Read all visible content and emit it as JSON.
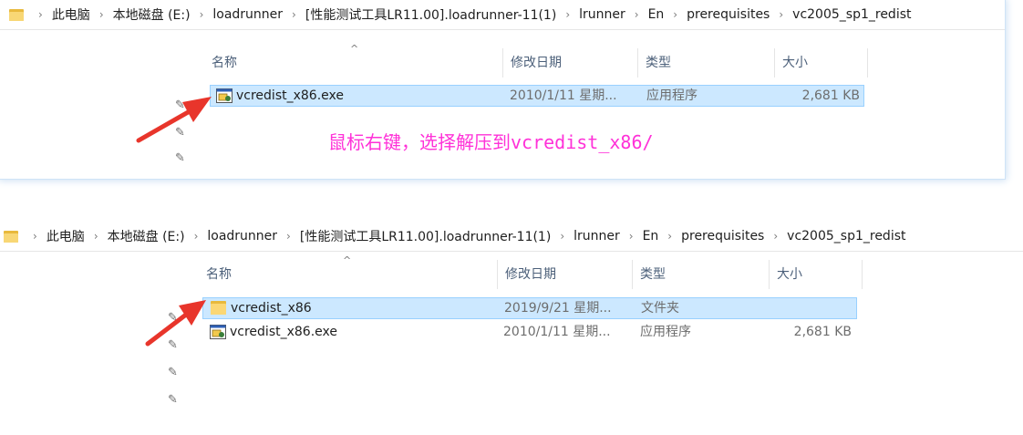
{
  "breadcrumb": {
    "items": [
      "此电脑",
      "本地磁盘 (E:)",
      "loadrunner",
      "[性能测试工具LR11.00].loadrunner-11(1)",
      "lrunner",
      "En",
      "prerequisites",
      "vc2005_sp1_redist"
    ]
  },
  "columns": {
    "name": "名称",
    "modified": "修改日期",
    "type": "类型",
    "size": "大小"
  },
  "panel1": {
    "files": [
      {
        "name": "vcredist_x86.exe",
        "modified": "2010/1/11 星期...",
        "type": "应用程序",
        "size": "2,681 KB",
        "icon": "exe-icon"
      }
    ],
    "annotation": "鼠标右键，选择解压到vcredist_x86/"
  },
  "panel2": {
    "files": [
      {
        "name": "vcredist_x86",
        "modified": "2019/9/21 星期...",
        "type": "文件夹",
        "size": "",
        "icon": "folder-icon"
      },
      {
        "name": "vcredist_x86.exe",
        "modified": "2010/1/11 星期...",
        "type": "应用程序",
        "size": "2,681 KB",
        "icon": "exe-icon"
      }
    ]
  },
  "colors": {
    "selection_bg": "#cce8ff",
    "selection_border": "#99d1ff",
    "annotation": "#ff31d8",
    "arrow": "#e8352b"
  }
}
